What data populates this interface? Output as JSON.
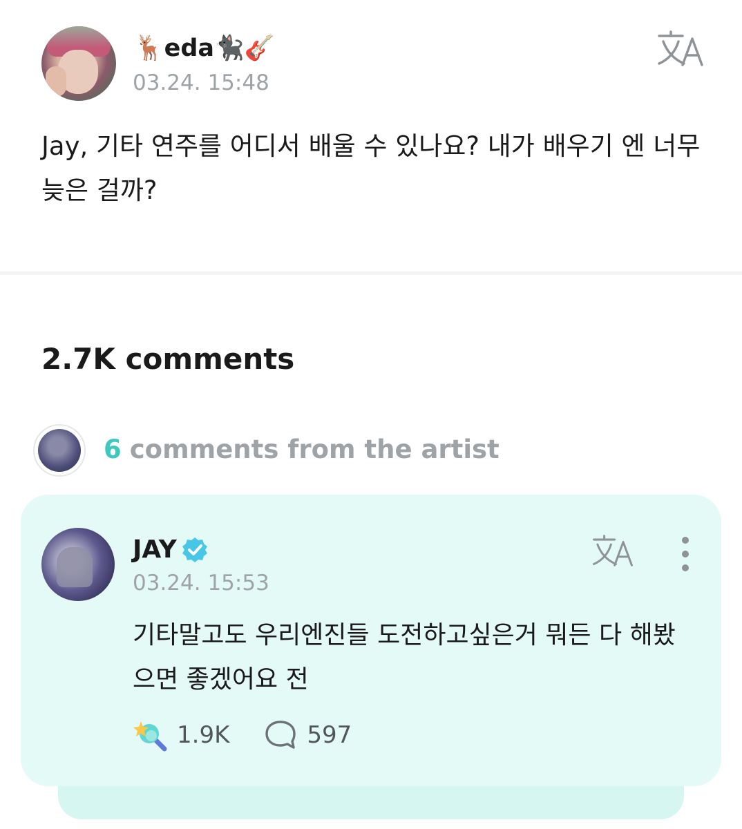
{
  "post": {
    "username": "🦌eda🐈‍⬛🎸",
    "timestamp": "03.24. 15:48",
    "text": "Jay, 기타 연주를 어디서 배울 수 있나요? 내가 배우기 엔 너무 늦은 걸까?"
  },
  "comments": {
    "count_label": "2.7K comments"
  },
  "artist_comments": {
    "count": "6",
    "label": "comments from the artist"
  },
  "comment": {
    "author": "JAY",
    "timestamp": "03.24. 15:53",
    "text": "기타말고도 우리엔진들 도전하고싶은거 뭐든 다 해봤으면 좋겠어요 전",
    "likes": "1.9K",
    "replies": "597"
  },
  "colors": {
    "accent": "#3fc8c0",
    "card_background": "#e4faf7",
    "muted_text": "#9ea3a8"
  },
  "icons": {
    "translate": "translate-icon",
    "verified": "verified-badge-icon",
    "more": "more-vertical-icon",
    "like": "lightstick-like-icon",
    "reply": "comment-bubble-icon"
  }
}
